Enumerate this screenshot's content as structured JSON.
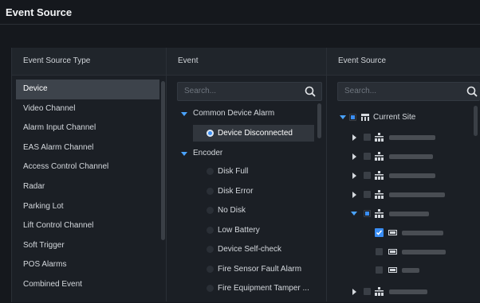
{
  "page": {
    "title": "Event Source"
  },
  "columns": {
    "source_type": "Event Source Type",
    "event": "Event",
    "event_source": "Event Source"
  },
  "source_types": [
    "Device",
    "Video Channel",
    "Alarm Input Channel",
    "EAS Alarm Channel",
    "Access Control Channel",
    "Radar",
    "Parking Lot",
    "Lift Control Channel",
    "Soft Trigger",
    "POS Alarms",
    "Combined Event"
  ],
  "selected_source_type": "Device",
  "event_search": {
    "placeholder": "Search..."
  },
  "source_search": {
    "placeholder": "Search..."
  },
  "event_tree": {
    "group1": {
      "label": "Common Device Alarm",
      "items": [
        "Device Disconnected"
      ]
    },
    "group2": {
      "label": "Encoder",
      "items": [
        "Disk Full",
        "Disk Error",
        "No Disk",
        "Low Battery",
        "Device Self-check",
        "Fire Sensor Fault Alarm",
        "Fire Equipment Tamper ..."
      ]
    },
    "selected_event": "Device Disconnected"
  },
  "source_tree": {
    "root_label": "Current Site",
    "root_state": "partial"
  },
  "colors": {
    "accent": "#3a8ef5",
    "background": "#15181d",
    "panel": "#1b1f25"
  }
}
